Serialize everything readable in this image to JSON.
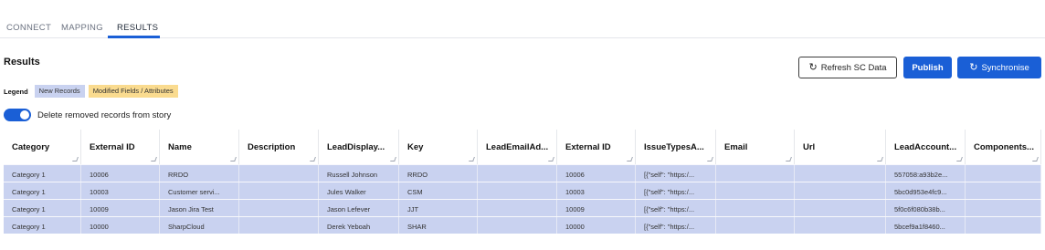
{
  "tabs": [
    {
      "label": "CONNECT"
    },
    {
      "label": "MAPPING"
    },
    {
      "label": "RESULTS",
      "active": true
    }
  ],
  "header": {
    "title": "Results",
    "refresh_label": "Refresh SC Data",
    "publish_label": "Publish",
    "sync_label": "Synchronise"
  },
  "legend": {
    "label": "Legend",
    "new_label": "New Records",
    "modified_label": "Modified Fields / Attributes"
  },
  "toggle": {
    "label": "Delete removed records from story",
    "on": true
  },
  "table": {
    "columns": [
      "Category",
      "External ID",
      "Name",
      "Description",
      "LeadDisplay...",
      "Key",
      "LeadEmailAd...",
      "External ID",
      "IssueTypesA...",
      "Email",
      "Url",
      "LeadAccount...",
      "Components..."
    ],
    "rows": [
      [
        "Category 1",
        "10006",
        "RRDO",
        "",
        "Russell Johnson",
        "RRDO",
        "",
        "10006",
        "[{\"self\": \"https:/...",
        "",
        "",
        "557058:a93b2e...",
        ""
      ],
      [
        "Category 1",
        "10003",
        "Customer servi...",
        "",
        "Jules Walker",
        "CSM",
        "",
        "10003",
        "[{\"self\": \"https:/...",
        "",
        "",
        "5bc0d953e4fc9...",
        ""
      ],
      [
        "Category 1",
        "10009",
        "Jason Jira Test",
        "",
        "Jason Lefever",
        "JJT",
        "",
        "10009",
        "[{\"self\": \"https:/...",
        "",
        "",
        "5f0c6f080b38b...",
        ""
      ],
      [
        "Category 1",
        "10000",
        "SharpCloud",
        "",
        "Derek Yeboah",
        "SHAR",
        "",
        "10000",
        "[{\"self\": \"https:/...",
        "",
        "",
        "5bcef9a1f8460...",
        ""
      ]
    ]
  },
  "colors": {
    "accent": "#1a5fd6",
    "new_record": "#c9d2f0",
    "modified": "#fadb8f"
  },
  "icons": {
    "refresh": "refresh-icon",
    "sync": "sync-icon"
  }
}
